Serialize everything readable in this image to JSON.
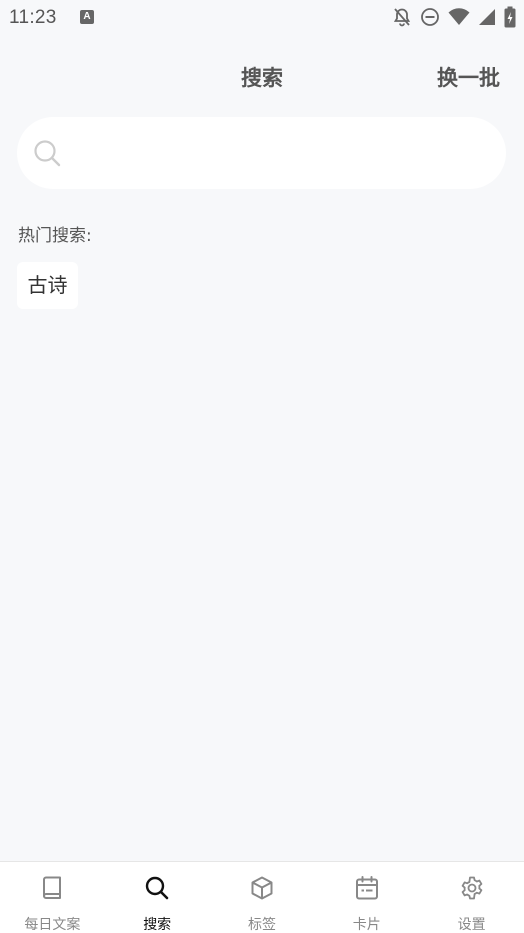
{
  "status_bar": {
    "time": "11:23",
    "app_icon_letter": "A"
  },
  "header": {
    "title": "搜索",
    "action_label": "换一批"
  },
  "search": {
    "value": "",
    "placeholder": ""
  },
  "hot_search": {
    "label": "热门搜索:",
    "tags": [
      "古诗"
    ]
  },
  "bottom_nav": {
    "active_index": 1,
    "items": [
      {
        "label": "每日文案",
        "icon": "book-icon"
      },
      {
        "label": "搜索",
        "icon": "search-icon"
      },
      {
        "label": "标签",
        "icon": "cube-icon"
      },
      {
        "label": "卡片",
        "icon": "calendar-icon"
      },
      {
        "label": "设置",
        "icon": "gear-icon"
      }
    ]
  },
  "colors": {
    "background": "#f7f8fa",
    "card": "#ffffff",
    "active": "#111111",
    "inactive": "#888888"
  }
}
